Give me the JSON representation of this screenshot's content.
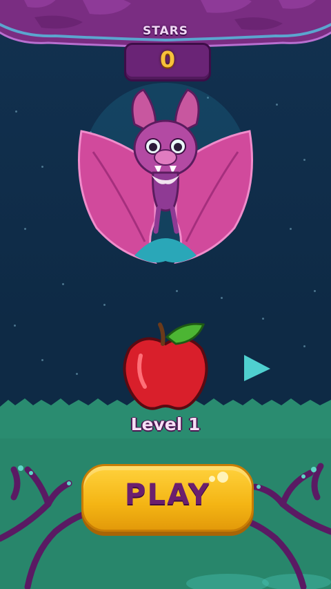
{
  "header": {
    "stars_label": "STARS",
    "stars_count": "0"
  },
  "level": {
    "label": "Level 1"
  },
  "play_button": {
    "label": "PLAY"
  },
  "icons": {
    "bat": "bat-character-icon",
    "apple": "apple-level-icon",
    "next": "next-level-arrow-icon"
  },
  "colors": {
    "sky": "#0e2a45",
    "rock": "#7a2d82",
    "grass": "#2a8c70",
    "button": "#f4b514",
    "button_text": "#6b1f6e",
    "arrow": "#4fd0cf"
  }
}
